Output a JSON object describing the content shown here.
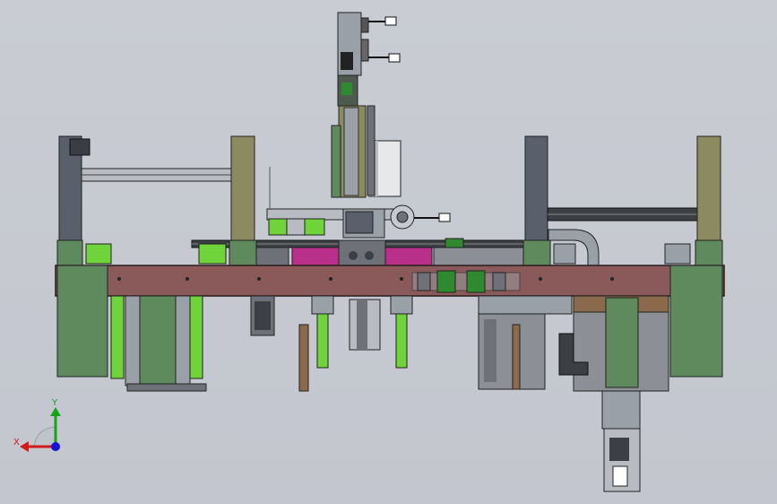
{
  "viewport": {
    "background": "#c6c9d0"
  },
  "triad": {
    "x_label": "X",
    "y_label": "Y",
    "x_color": "#d21a1a",
    "y_color": "#17a317",
    "z_color": "#1414d8"
  },
  "palette": {
    "main_beam": "#8a5a5a",
    "beam_edge": "#2a1a1a",
    "post_olive": "#8c8a60",
    "post_slate": "#5a5f6c",
    "enclosure_green": "#5e8a5e",
    "cylinder_green": "#6fd33a",
    "magenta": "#b8308a",
    "steel": "#9aa0a8",
    "dark_steel": "#3c3f44",
    "brown_plate": "#8a6a4a"
  }
}
